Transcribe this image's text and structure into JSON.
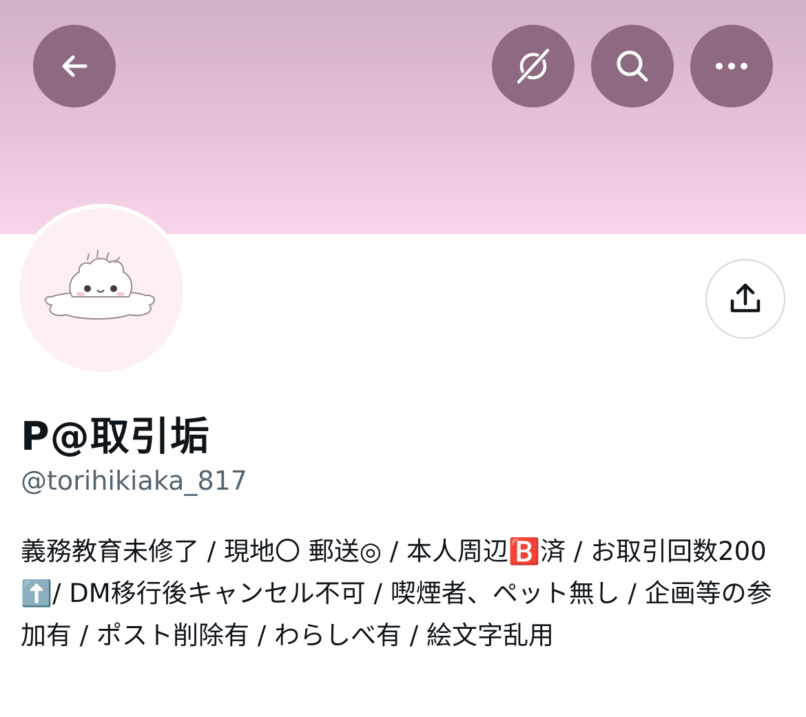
{
  "header": {
    "back_icon": "arrow-left-icon",
    "grok_icon": "grok-icon",
    "search_icon": "search-icon",
    "more_icon": "more-horizontal-icon",
    "banner_colors": [
      "#d0b1c4",
      "#f8d6ea"
    ],
    "button_color": "#8d6a7f"
  },
  "profile": {
    "avatar": "white-fluffy-cat-avatar",
    "display_name": "P@取引垢",
    "handle": "@torihikiaka_817",
    "bio": "義務教育未修了 / 現地〇 郵送◎ / 本人周辺🅱️済 / お取引回数200⬆️/ DM移行後キャンセル不可 / 喫煙者、ペット無し / 企画等の参加有 / ポスト削除有 / わらしべ有 / 絵文字乱用",
    "share_icon": "share-icon"
  },
  "colors": {
    "text_primary": "#0f1419",
    "text_secondary": "#536471",
    "border": "#cfd9de"
  }
}
